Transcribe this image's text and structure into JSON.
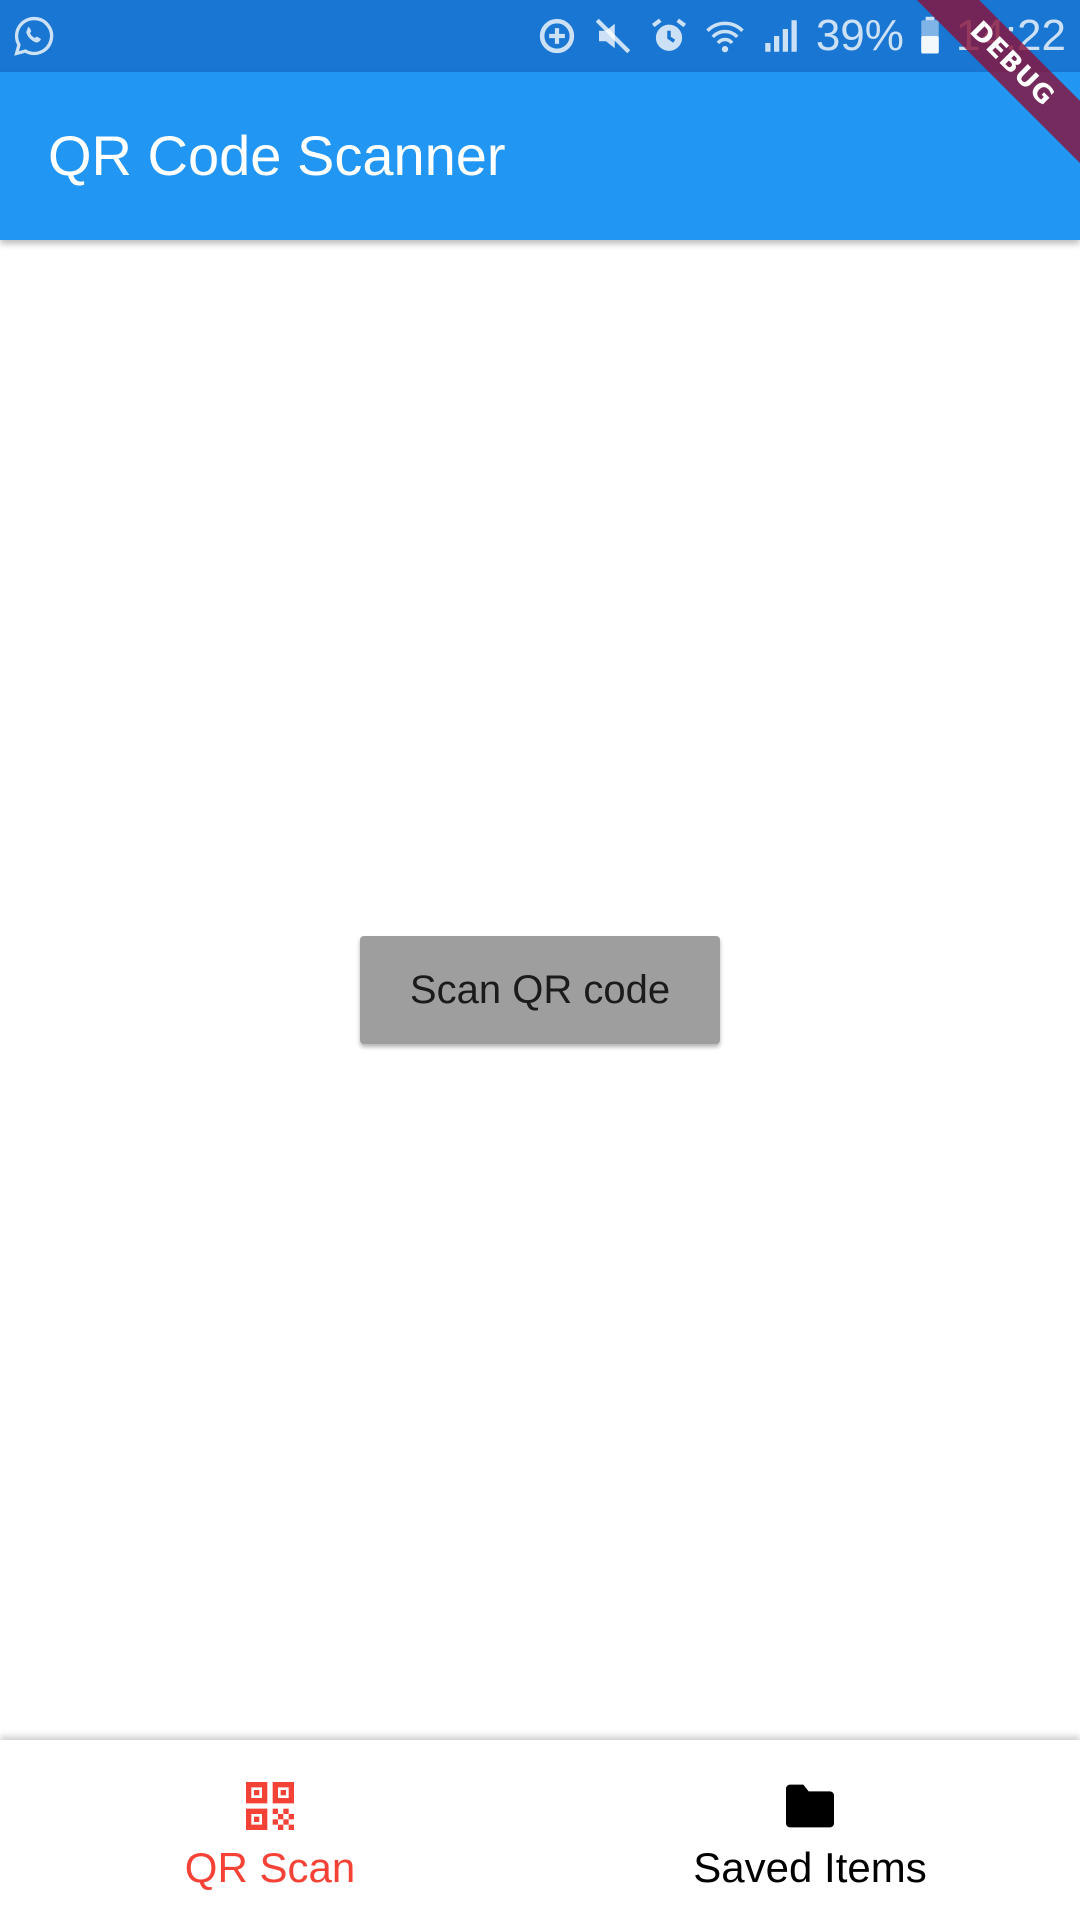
{
  "status_bar": {
    "battery_percent": "39%",
    "time": "14:22",
    "icons": [
      "whatsapp-icon",
      "data-saver-icon",
      "mute-icon",
      "alarm-icon",
      "wifi-icon",
      "signal-icon",
      "battery-icon"
    ]
  },
  "debug_banner": "DEBUG",
  "app_bar": {
    "title": "QR Code Scanner",
    "color": "#2196f3"
  },
  "main": {
    "scan_button_label": "Scan QR code",
    "scan_button_color": "#9e9e9e"
  },
  "bottom_nav": {
    "items": [
      {
        "label": "QR Scan",
        "icon": "qr-code-icon",
        "selected": true,
        "color": "#f44336"
      },
      {
        "label": "Saved Items",
        "icon": "folder-icon",
        "selected": false,
        "color": "#000000"
      }
    ]
  }
}
